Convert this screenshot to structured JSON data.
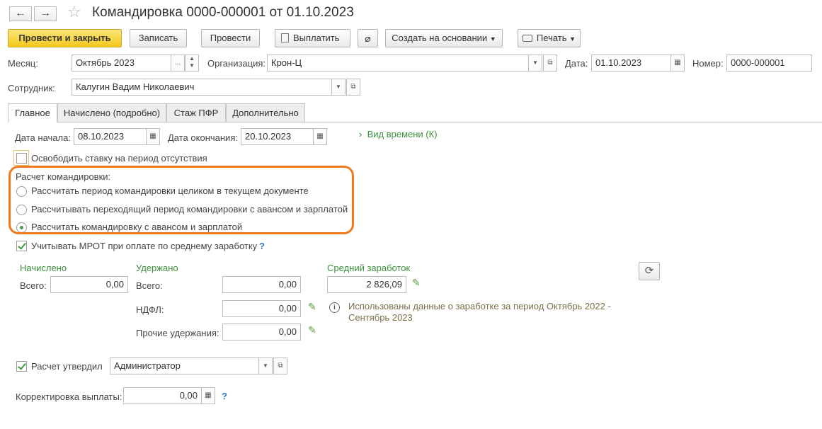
{
  "window": {
    "title": "Командировка 0000-000001 от 01.10.2023",
    "back_icon": "←",
    "forward_icon": "→",
    "star_icon": "☆"
  },
  "toolbar": {
    "post_close": "Провести и закрыть",
    "save": "Записать",
    "post": "Провести",
    "pay": "Выплатить",
    "create_based": "Создать на основании",
    "print": "Печать"
  },
  "header": {
    "month_label": "Месяц:",
    "month_value": "Октябрь 2023",
    "org_label": "Организация:",
    "org_value": "Крон-Ц",
    "date_label": "Дата:",
    "date_value": "01.10.2023",
    "number_label": "Номер:",
    "number_value": "0000-000001",
    "employee_label": "Сотрудник:",
    "employee_value": "Калугин Вадим Николаевич"
  },
  "tabs": [
    {
      "label": "Главное"
    },
    {
      "label": "Начислено (подробно)"
    },
    {
      "label": "Стаж ПФР"
    },
    {
      "label": "Дополнительно"
    }
  ],
  "main": {
    "start_label": "Дата начала:",
    "start_value": "08.10.2023",
    "end_label": "Дата окончания:",
    "end_value": "20.10.2023",
    "time_type_link": "Вид времени (К)",
    "free_rate_label": "Освободить ставку на период отсутствия",
    "free_rate_checked": false,
    "calc_group_label": "Расчет командировки:",
    "calc_options": [
      {
        "label": "Рассчитать период командировки целиком в текущем документе",
        "selected": false
      },
      {
        "label": "Рассчитывать переходящий период командировки с авансом и зарплатой",
        "selected": false
      },
      {
        "label": "Рассчитать командировку с авансом и зарплатой",
        "selected": true
      }
    ],
    "mrot_label": "Учитывать МРОТ при оплате по среднему заработку",
    "mrot_checked": true,
    "accrued_header": "Начислено",
    "accrued_total_label": "Всего:",
    "accrued_total_value": "0,00",
    "withheld_header": "Удержано",
    "withheld_total_label": "Всего:",
    "withheld_total_value": "0,00",
    "ndfl_label": "НДФЛ:",
    "ndfl_value": "0,00",
    "other_label": "Прочие удержания:",
    "other_value": "0,00",
    "avg_header": "Средний заработок",
    "avg_value": "2 826,09",
    "info_text_1": "Использованы данные о заработке за период Октябрь 2022 -",
    "info_text_2": "Сентябрь 2023",
    "approved_label": "Расчет утвердил",
    "approved_checked": true,
    "approved_value": "Администратор",
    "correction_label": "Корректировка выплаты:",
    "correction_value": "0,00",
    "question": "?"
  },
  "colors": {
    "accent_yellow": "#f4c91c",
    "highlight_orange": "#f07a1e",
    "green_text": "#3c8f3c"
  }
}
